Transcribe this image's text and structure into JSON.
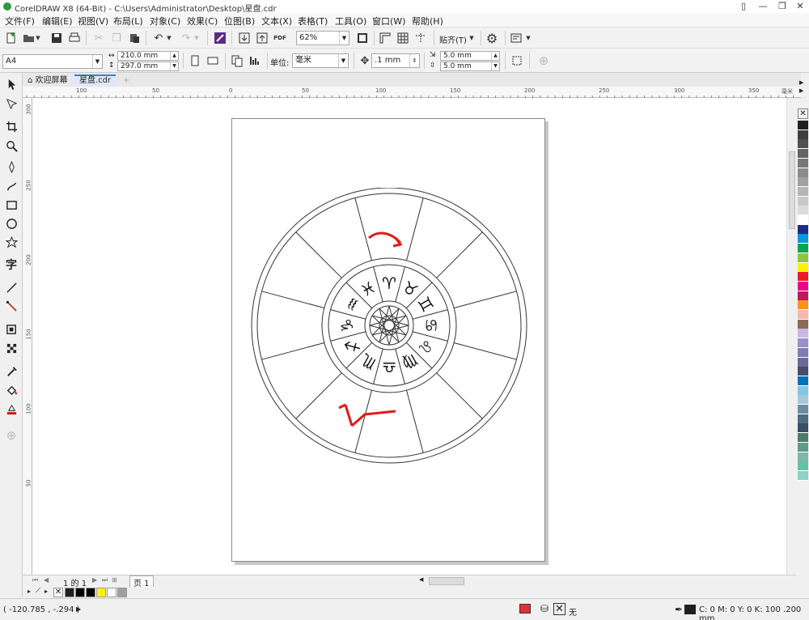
{
  "window": {
    "title": "CorelDRAW X8 (64-Bit) - C:\\Users\\Administrator\\Desktop\\星盘.cdr"
  },
  "menu": [
    "文件(F)",
    "编辑(E)",
    "视图(V)",
    "布局(L)",
    "对象(C)",
    "效果(C)",
    "位图(B)",
    "文本(X)",
    "表格(T)",
    "工具(O)",
    "窗口(W)",
    "帮助(H)"
  ],
  "toolbar": {
    "zoom": "62%",
    "snap_label": "贴齐(T)",
    "pdf_label": "PDF"
  },
  "property_bar": {
    "page_size": "A4",
    "width": "210.0 mm",
    "height": "297.0 mm",
    "unit_label": "单位:",
    "unit": "毫米",
    "nudge": ".1 mm",
    "dup_x": "5.0 mm",
    "dup_y": "5.0 mm"
  },
  "tabs": [
    {
      "label": "欢迎屏幕"
    },
    {
      "label": "星盘.cdr"
    }
  ],
  "ruler": {
    "h_labels": [
      "100",
      "50",
      "0",
      "50",
      "100",
      "150",
      "200",
      "250",
      "300",
      "350",
      "毫米"
    ],
    "v_labels": [
      "300",
      "250",
      "200",
      "150",
      "100",
      "50"
    ]
  },
  "zodiac_glyphs": [
    "♈",
    "♉",
    "♊",
    "♋",
    "♌",
    "♍",
    "♎",
    "♏",
    "♐",
    "♑",
    "♒",
    "♓"
  ],
  "page_nav": {
    "position": "1 的 1",
    "page_tab": "页 1"
  },
  "status": {
    "coords": "( -120.785 , -.294 )",
    "fill_none": "无",
    "outline_info": "C: 0 M: 0 Y: 0 K: 100  .200 mm"
  },
  "colors": {
    "accent": "#3b7fd6",
    "arrow_red": "#e01b1b",
    "palette": [
      "#231f20",
      "#3d3d3d",
      "#505050",
      "#646464",
      "#787878",
      "#8c8c8c",
      "#a0a0a0",
      "#b4b4b4",
      "#c8c8c8",
      "#dcdcdc",
      "#ffffff",
      "#1e2a8a",
      "#0099dd",
      "#00a651",
      "#8dc63f",
      "#fff200",
      "#ed1c24",
      "#ec008c",
      "#c2185b",
      "#f7941d",
      "#f5b7b1",
      "#8b6a5a",
      "#c7b8e0",
      "#9b8fc7",
      "#7d7db8",
      "#6a6a9a",
      "#4a4a6a",
      "#0072bc",
      "#7ec8e3",
      "#a7c7dc",
      "#6b8ca3",
      "#4f6b7f",
      "#3a4f5f",
      "#4e7a6a",
      "#5f9a8a",
      "#7fb8a8",
      "#66c2a5",
      "#8ed1c6"
    ],
    "doc_palette": [
      "#231f20",
      "#000000",
      "#000000",
      "#fff200",
      "#ffffff",
      "#a0a0a0"
    ]
  }
}
